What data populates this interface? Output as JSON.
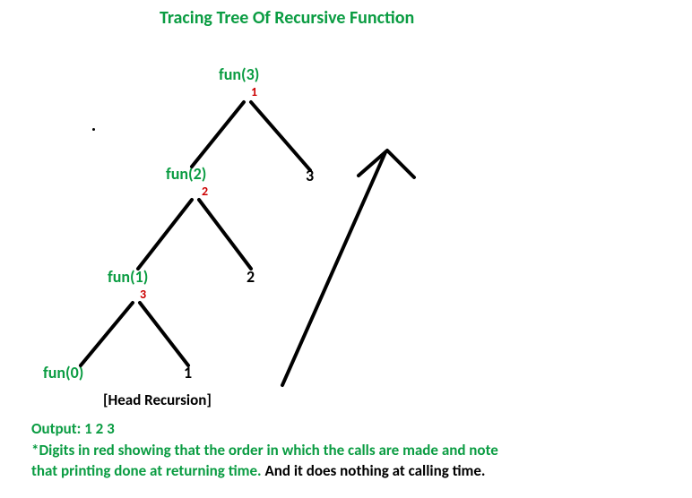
{
  "title": "Tracing Tree Of Recursive Function",
  "nodes": {
    "fun3": "fun(3)",
    "fun2": "fun(2)",
    "fun1": "fun(1)",
    "fun0": "fun(0)"
  },
  "steps": {
    "s1": "1",
    "s2": "2",
    "s3": "3"
  },
  "prints": {
    "p3": "3",
    "p2": "2",
    "p1": "1"
  },
  "caption": "[Head Recursion]",
  "output_label": "Output: 1 2 3",
  "note_line1": "*Digits in red showing that the order in which the calls are made and note",
  "note_line2a": "that printing done at returning time.",
  "note_line2b": "And it does nothing at calling time."
}
